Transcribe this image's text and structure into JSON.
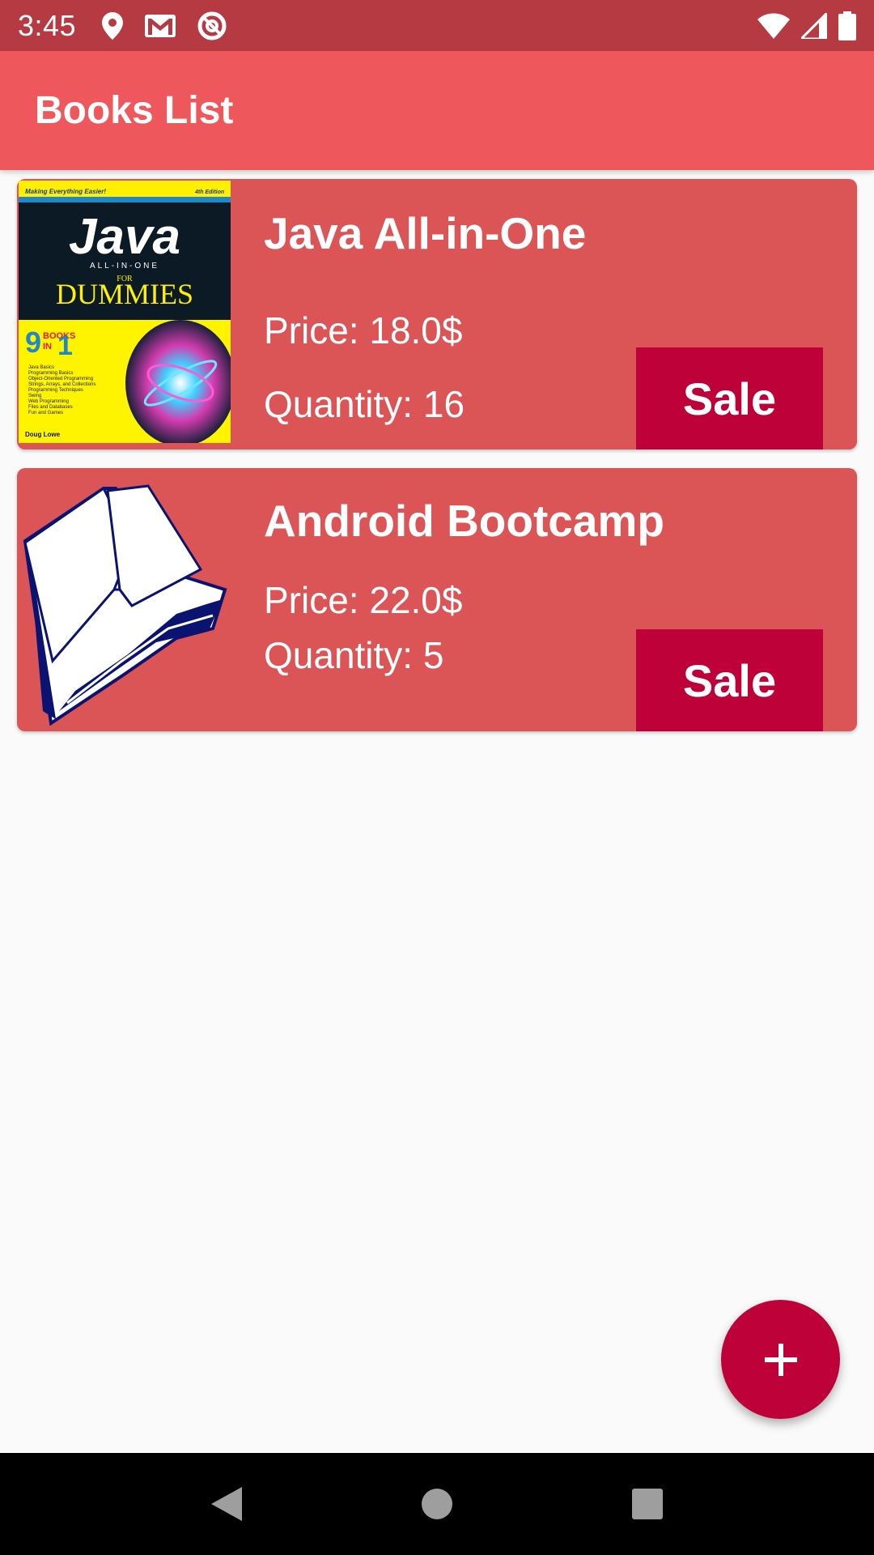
{
  "status_bar": {
    "time": "3:45",
    "left_icons": [
      "location-icon",
      "gmail-icon",
      "no-disturb-icon"
    ],
    "right_icons": [
      "wifi-icon",
      "signal-icon",
      "battery-icon"
    ]
  },
  "app_bar": {
    "title": "Books List"
  },
  "books": [
    {
      "title": "Java All-in-One For Dummies",
      "price": "Price: 18.0$",
      "quantity": "Quantity: 16",
      "sale_label": "Sale",
      "cover": "java-dummies-cover",
      "cover_texts": {
        "tagline": "Making Everything Easier!",
        "edition": "4th Edition",
        "main": "Java",
        "subtitle": "ALL-IN-ONE",
        "for": "FOR",
        "dummies": "DUMMIES",
        "nine": "9",
        "books": "BOOKS",
        "in": "IN",
        "one": "1",
        "topics": [
          "Java Basics",
          "Programming Basics",
          "Object-Oriented Programming",
          "Strings, Arrays, and Collections",
          "Programming Techniques",
          "Swing",
          "Web Programming",
          "Files and Databases",
          "Fun and Games"
        ],
        "author": "Doug Lowe"
      }
    },
    {
      "title": "Android Bootcamp",
      "price": "Price: 22.0$",
      "quantity": "Quantity: 5",
      "sale_label": "Sale",
      "cover": "open-book-icon"
    }
  ],
  "fab": {
    "icon": "plus-icon"
  },
  "nav_bar": {
    "buttons": [
      "back-icon",
      "home-icon",
      "recents-icon"
    ]
  },
  "colors": {
    "status_bar": "#b53a42",
    "app_bar": "#ee585c",
    "card": "#db5456",
    "accent": "#be0138",
    "background": "#fafafa"
  }
}
